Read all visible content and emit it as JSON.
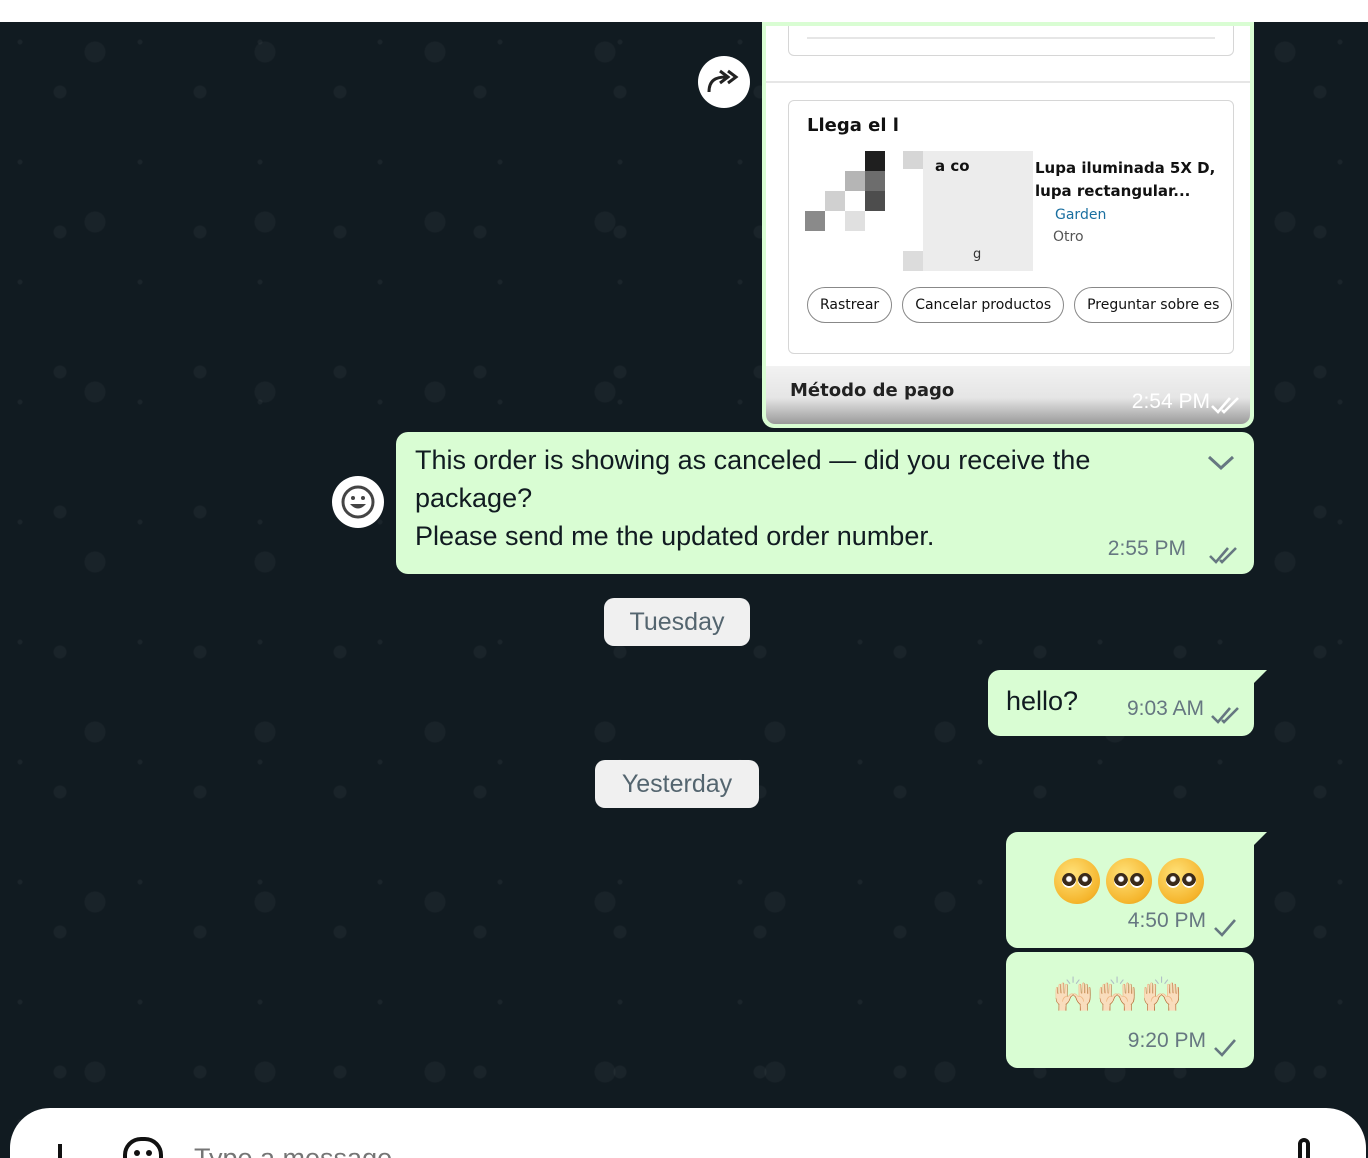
{
  "image_message": {
    "card_title": "Llega el l",
    "product_name": "Lupa iluminada 5X D, lupa rectangular...",
    "product_name_fragment": "a co",
    "product_name_fragment2": "g",
    "store": "Garden",
    "type": "Otro",
    "actions": [
      "Rastrear",
      "Cancelar productos",
      "Preguntar sobre es"
    ],
    "payment_label": "Método de pago",
    "time": "2:54 PM",
    "status": "read"
  },
  "forward_icon": "forward-icon",
  "reaction_icon": "emoji-reaction-icon",
  "messages": [
    {
      "text": "This order is showing as canceled — did you receive the package?\nPlease send me the updated order number.",
      "time": "2:55 PM",
      "status": "read"
    },
    {
      "text": "hello?",
      "time": "9:03 AM",
      "status": "read"
    },
    {
      "emoji": "🥹🥹🥹",
      "time": "4:50 PM",
      "status": "sent"
    },
    {
      "emoji": "🙌🏻🙌🏻🙌🏻",
      "time": "9:20 PM",
      "status": "sent"
    }
  ],
  "date_separators": [
    "Tuesday",
    "Yesterday"
  ],
  "composer": {
    "placeholder": "Type a message"
  },
  "colors": {
    "outgoing_bubble": "#d9fdd3",
    "chat_background": "#111b21",
    "tick_read": "#667781"
  }
}
